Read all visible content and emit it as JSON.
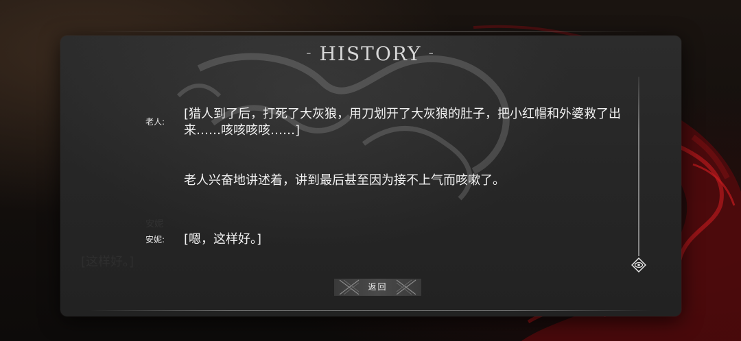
{
  "history": {
    "title": "HISTORY",
    "title_dash_left": "-",
    "title_dash_right": "-"
  },
  "entries": [
    {
      "speaker": "老人:",
      "text": "[猎人到了后，打死了大灰狼，用刀划开了大灰狼的肚子，把小红帽和外婆救了出来……咳咳咳咳……]"
    },
    {
      "speaker": "",
      "text": "老人兴奋地讲述着，讲到最后甚至因为接不上气而咳嗽了。"
    },
    {
      "speaker": "安妮:",
      "text": "[嗯，这样好。]"
    }
  ],
  "ghost": {
    "name": "安妮",
    "text": "[这样好。]"
  },
  "back_button": {
    "label": "返回"
  },
  "icons": {
    "scroll_thumb": "eye-icon"
  },
  "colors": {
    "accent_red": "#8b0f12",
    "panel_bg": "#262626",
    "text": "#f2f2f2"
  }
}
